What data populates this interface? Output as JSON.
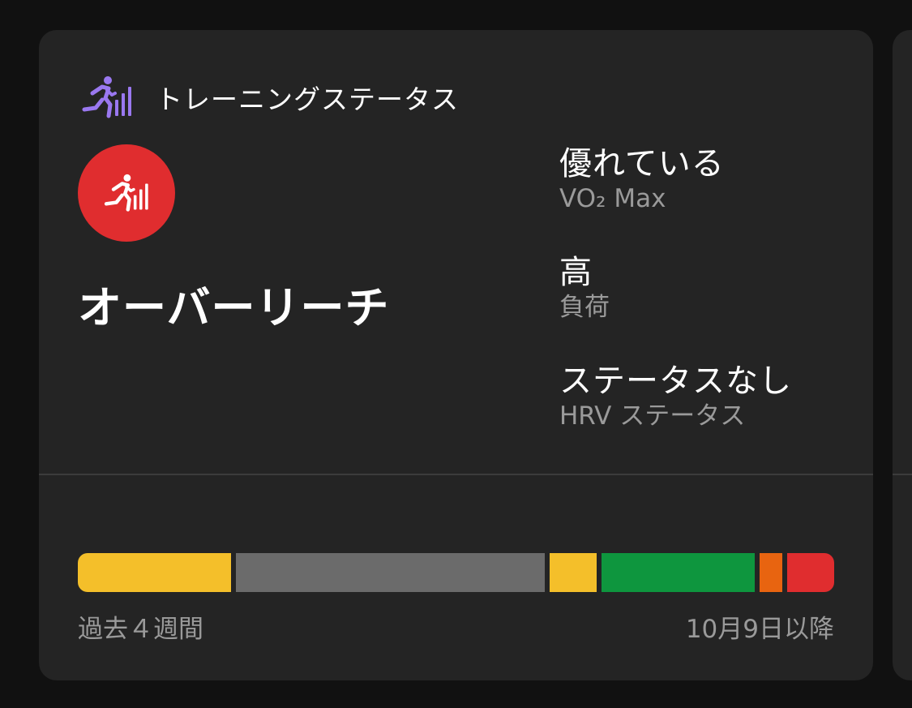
{
  "card": {
    "title": "トレーニングステータス",
    "status": {
      "label": "オーバーリーチ",
      "color": "#e02d2f"
    },
    "metrics": [
      {
        "value": "優れている",
        "label": "VO₂ Max"
      },
      {
        "value": "高",
        "label": "負荷"
      },
      {
        "value": "ステータスなし",
        "label": "HRV ステータス"
      }
    ],
    "timeline": {
      "segments": [
        {
          "status": "yellow",
          "color": "#f4bf2a",
          "fraction": 0.209
        },
        {
          "status": "gray",
          "color": "#6b6b6b",
          "fraction": 0.422
        },
        {
          "status": "yellow",
          "color": "#f4bf2a",
          "fraction": 0.064
        },
        {
          "status": "green",
          "color": "#0e963e",
          "fraction": 0.209
        },
        {
          "status": "orange",
          "color": "#e86410",
          "fraction": 0.031
        },
        {
          "status": "red",
          "color": "#e02d2f",
          "fraction": 0.036
        }
      ],
      "left_caption": "過去４週間",
      "right_caption": "10月9日以降"
    }
  },
  "icons": {
    "header": "training-status-icon",
    "status": "training-status-icon"
  },
  "colors": {
    "accent_purple": "#9a78f0",
    "background": "#111111",
    "card": "#242424"
  }
}
